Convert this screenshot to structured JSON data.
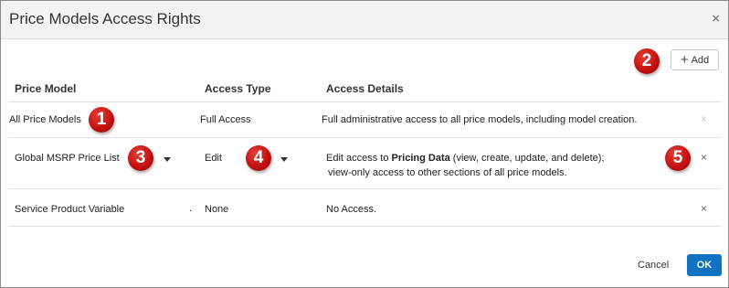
{
  "dialog": {
    "title": "Price Models Access Rights",
    "close_glyph": "×"
  },
  "toolbar": {
    "add_label": "Add",
    "add_icon": "plus-icon"
  },
  "columns": {
    "price_model": "Price Model",
    "access_type": "Access Type",
    "access_details": "Access Details"
  },
  "rows": [
    {
      "price_model": "All Price Models",
      "access_type": "Full Access",
      "access_details": "Full administrative access to all price models, including model creation.",
      "remove_enabled": false
    },
    {
      "price_model": "Global MSRP Price List",
      "access_type": "Edit",
      "details_prefix": "Edit access to ",
      "details_bold": "Pricing Data",
      "details_suffix": " (view, create, update, and delete);",
      "details_line2": "view-only access to other sections of all price models.",
      "remove_enabled": true
    },
    {
      "price_model": "Service Product Variable",
      "separator": ".",
      "access_type": "None",
      "access_details": "No Access.",
      "remove_enabled": true
    }
  ],
  "callouts": [
    "1",
    "2",
    "3",
    "4",
    "5"
  ],
  "footer": {
    "cancel_label": "Cancel",
    "ok_label": "OK"
  },
  "colors": {
    "ok_button": "#0f73c1",
    "callout_badge": "#c5120f",
    "title_bar": "#f3f3f3"
  }
}
